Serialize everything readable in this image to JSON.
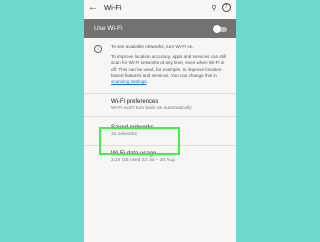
{
  "appbar": {
    "title": "Wi-Fi"
  },
  "wifi_toggle": {
    "label": "Use Wi-Fi",
    "state": "off"
  },
  "info": {
    "line1": "To see available networks, turn Wi-Fi on.",
    "line2": "To improve location accuracy, apps and services can still scan for Wi-Fi networks at any time, even when Wi-Fi is off. This can be used, for example, to improve location-based features and services. You can change this in",
    "link": "scanning settings",
    "end": "."
  },
  "items": [
    {
      "title": "Wi-Fi preferences",
      "subtitle": "Wi-Fi won't turn back on automatically"
    },
    {
      "title": "Saved networks",
      "subtitle": "34 networks"
    },
    {
      "title": "Wi-Fi data usage",
      "subtitle": "3.34 GB used 23 Jul – 20 Aug"
    }
  ],
  "colors": {
    "background": "#6fd8cf",
    "highlight": "#44ee44",
    "toggle_bar": "#727272",
    "link": "#1a73e8"
  }
}
